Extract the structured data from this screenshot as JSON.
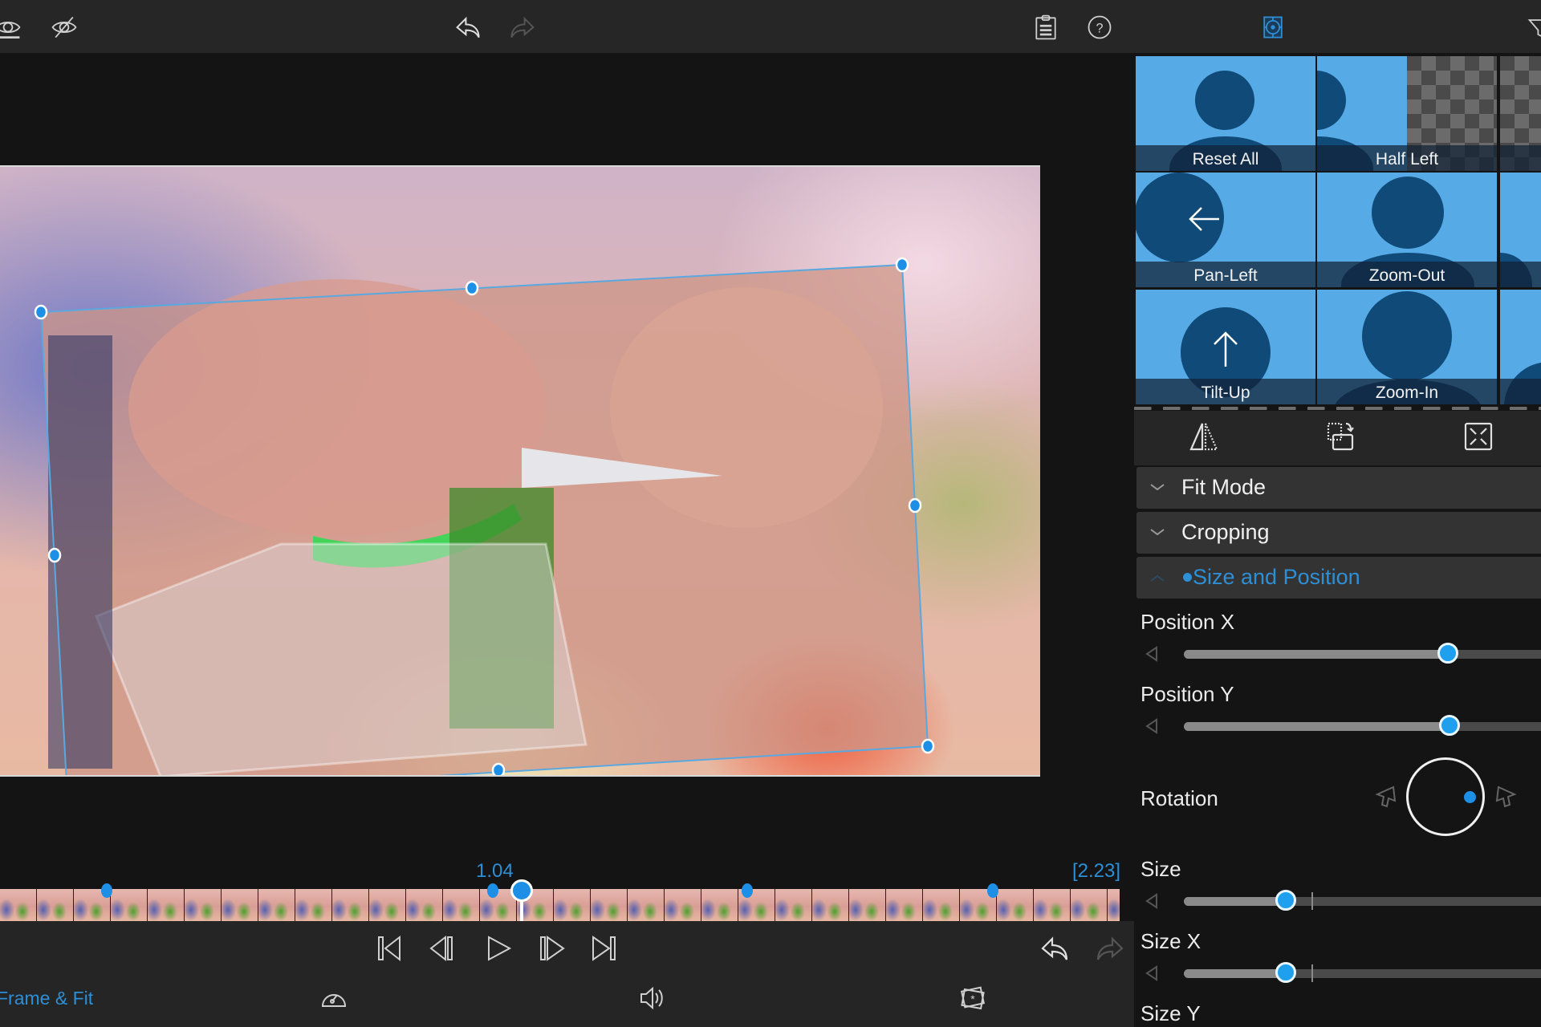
{
  "toolbar": {
    "left_icons": [
      "eye-show-icon",
      "eye-hide-icon"
    ],
    "undo_icon": "undo-icon",
    "redo_icon": "redo-icon",
    "clipboard_icon": "clipboard-icon",
    "help_icon": "help-icon",
    "active_tool_icon": "pan-zoom-target-icon",
    "right_edge_icon": "filter-icon"
  },
  "colors": {
    "accent": "#2d8fd6",
    "tile_bg": "#56aae6",
    "tile_figure": "#0f4a79",
    "toolbar_bg": "#262626",
    "panel_bg": "#141414",
    "knob": "#1fa0ef"
  },
  "presets": [
    {
      "label": "Reset All",
      "type": "person"
    },
    {
      "label": "Half Left",
      "type": "half-left"
    },
    {
      "label": "",
      "type": "checker"
    },
    {
      "label": "Pan-Left",
      "type": "pan-left"
    },
    {
      "label": "Zoom-Out",
      "type": "person"
    },
    {
      "label": "",
      "type": "person-partial"
    },
    {
      "label": "Tilt-Up",
      "type": "tilt-up"
    },
    {
      "label": "Zoom-In",
      "type": "zoom-in"
    },
    {
      "label": "",
      "type": "person-partial"
    }
  ],
  "panel_tools": [
    "flip-icon",
    "rotate-frame-icon",
    "fit-to-frame-icon"
  ],
  "sections": [
    {
      "label": "Fit Mode",
      "expanded": false
    },
    {
      "label": "Cropping",
      "expanded": false
    },
    {
      "label": "Size and Position",
      "expanded": true,
      "modified_dot": true
    }
  ],
  "properties": {
    "position_x": {
      "label": "Position X",
      "value_fraction": 0.62
    },
    "position_y": {
      "label": "Position Y",
      "value_fraction": 0.625
    },
    "rotation": {
      "label": "Rotation",
      "angle_deg": 0
    },
    "size": {
      "label": "Size",
      "value_fraction": 0.24,
      "default_fraction": 0.3
    },
    "size_x": {
      "label": "Size X",
      "value_fraction": 0.24,
      "default_fraction": 0.3
    },
    "size_y": {
      "label": "Size Y"
    }
  },
  "timeline": {
    "current_time": "1.04",
    "duration": "[2.23]",
    "playhead_fraction": 0.466,
    "keyframe_fractions": [
      0.095,
      0.44,
      0.6675,
      0.8865
    ]
  },
  "transport": [
    "skip-to-start-icon",
    "step-back-icon",
    "play-icon",
    "step-forward-icon",
    "skip-to-end-icon"
  ],
  "bottom_bar": {
    "mode_label": "Frame & Fit",
    "icons": [
      "speed-icon",
      "volume-icon",
      "effects-icon"
    ]
  }
}
